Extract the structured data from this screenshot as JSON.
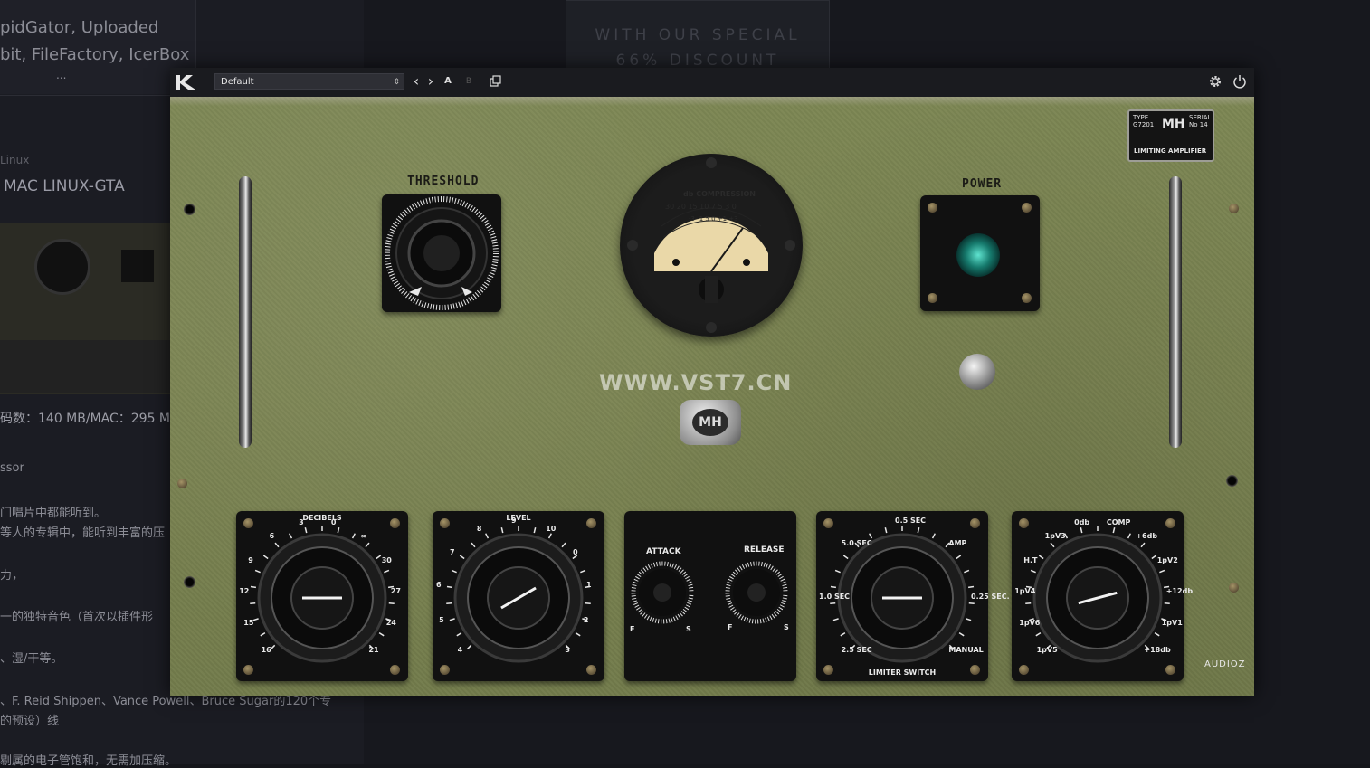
{
  "background_page": {
    "top_left_line1": "pidGator, Uploaded",
    "top_left_line2": "bit, FileFactory, IcerBox",
    "ellipsis": "...",
    "banner_line1": "WITH OUR SPECIAL",
    "banner_line2": "66% DISCOUNT",
    "os_label": "Linux",
    "os_title": "MAC LINUX-GTA",
    "size_text": "码数：140 MB/MAC：295 M",
    "ssor": "ssor",
    "cn1": "门唱片中都能听到。",
    "cn2": "等人的专辑中，能听到丰富的压",
    "cn3": "力，",
    "cn4": "一的独特音色（首次以插件形",
    "cn5": "、湿/干等。",
    "cn6": "、F. Reid Shippen、Vance Powell、Bruce Sugar的120个专",
    "cn7": "的预设）线",
    "cn8": "剔属的电子管饱和，无需加压缩。"
  },
  "toolbar": {
    "preset_value": "Default",
    "prev_label": "‹",
    "next_label": "›",
    "a_label": "A",
    "b_label": "B",
    "copy_icon": "copy-icon",
    "settings_icon": "gear-icon",
    "power_icon": "power-icon"
  },
  "panel": {
    "threshold_label": "THRESHOLD",
    "power_label": "POWER",
    "meter_title": "db COMPRESSION",
    "meter_scale": "30 20 15 10 7 5 3 0",
    "meter_scale2": "-3 -1 5 0 +1 +3",
    "watermark": "WWW.VST7.CN",
    "brand": "AUDIOZ",
    "plate_type": "TYPE",
    "plate_type_val": "G7201",
    "plate_serial": "SERIAL",
    "plate_serial_val": "No 14",
    "plate_logo": "MH",
    "plate_title": "LIMITING AMPLIFIER",
    "badge_logo": "MH",
    "decibels_label": "DECIBELS",
    "decibels_ticks": [
      "16",
      "15",
      "12",
      "9",
      "6",
      "3",
      "0",
      "∞",
      "30",
      "27",
      "24",
      "21"
    ],
    "level_label": "LEVEL",
    "level_ticks": [
      "4",
      "5",
      "6",
      "7",
      "8",
      "9",
      "10",
      "0",
      "1",
      "2",
      "3"
    ],
    "attack_label": "ATTACK",
    "release_label": "RELEASE",
    "fs_f": "F",
    "fs_s": "S",
    "limiter_label": "LIMITER SWITCH",
    "limiter_positions": [
      "2.5 SEC",
      "1.0 SEC",
      "5.0 SEC",
      "0.5 SEC",
      "AMP",
      "0.25 SEC.",
      "MANUAL"
    ],
    "tone_positions": [
      "1pV5",
      "1pV6",
      "1pV4",
      "H.T",
      "1pV3",
      "0db",
      "COMP",
      "+6db",
      "1pV2",
      "+12db",
      "1pV1",
      "+18db"
    ]
  }
}
